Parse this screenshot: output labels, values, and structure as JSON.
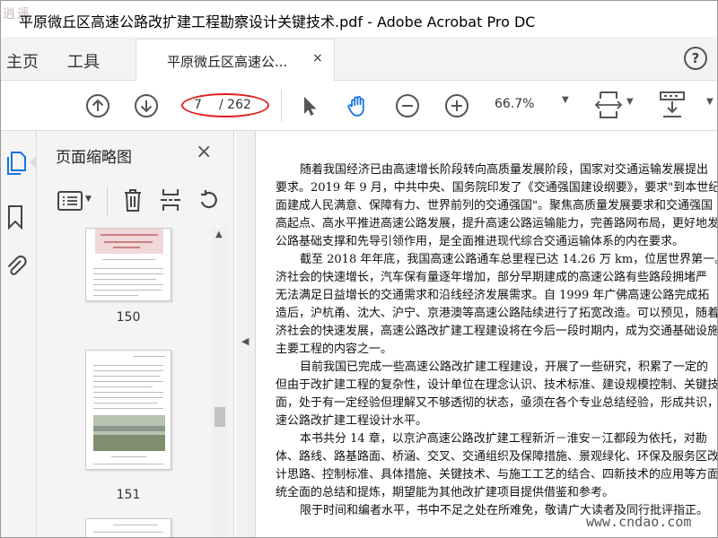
{
  "window": {
    "title": "平原微丘区高速公路改扩建工程勘察设计关键技术.pdf - Adobe Acrobat Pro DC",
    "corner_logo": "逍遥"
  },
  "menu": {
    "home": "主页",
    "tools": "工具",
    "doc_tab": "平原微丘区高速公...",
    "close_tab": "×",
    "help": "?"
  },
  "toolbar": {
    "page_current": "7",
    "page_total": "/ 262",
    "zoom": "66.7%"
  },
  "panel": {
    "title": "页面缩略图",
    "close": "×",
    "thumbs": [
      {
        "page": "150"
      },
      {
        "page": "151"
      }
    ]
  },
  "document": {
    "lines": [
      "随着我国经济已由高速增长阶段转向高质量发展阶段，国家对交通运输发展提出",
      "要求。2019 年 9 月，中共中央、国务院印发了《交通强国建设纲要》，要求\"到本世纪中",
      "面建成人民满意、保障有力、世界前列的交通强国\"。聚焦高质量发展要求和交通强国",
      "高起点、高水平推进高速公路发展，提升高速公路运输能力，完善路网布局，更好地发挥",
      "公路基础支撑和先导引领作用，是全面推进现代综合交通运输体系的内在要求。",
      "截至 2018 年年底，我国高速公路通车总里程已达 14.26 万 km，位居世界第一。",
      "济社会的快速增长，汽车保有量逐年增加，部分早期建成的高速公路有些路段拥堵严",
      "无法满足日益增长的交通需求和沿线经济发展需求。自 1999 年广佛高速公路完成拓",
      "造后，沪杭甬、沈大、沪宁、京港澳等高速公路陆续进行了拓宽改造。可以预见，随着我",
      "济社会的快速发展，高速公路改扩建工程建设将在今后一段时期内，成为交通基础设施",
      "主要工程的内容之一。",
      "目前我国已完成一些高速公路改扩建工程建设，开展了一些研究，积累了一定的",
      "但由于改扩建工程的复杂性，设计单位在理念认识、技术标准、建设规模控制、关键技术",
      "面，处于有一定经验但理解又不够透彻的状态，亟须在各个专业总结经验，形成共识，提",
      "速公路改扩建工程设计水平。",
      "本书共分 14 章，以京沪高速公路改扩建工程新沂－淮安－江都段为依托，对勘",
      "体、路线、路基路面、桥涵、交叉、交通组织及保障措施、景观绿化、环保及服务区改造等",
      "计思路、控制标准、具体措施、关键技术、与施工工艺的结合、四新技术的应用等方面进",
      "统全面的总结和提炼，期望能为其他改扩建项目提供借鉴和参考。",
      "限于时间和编者水平，书中不足之处在所难免，敬请广大读者及同行批评指正。"
    ]
  },
  "watermark": "www.cndao.com",
  "colors": {
    "accent_blue": "#1473e6",
    "highlight_red": "#e02020"
  }
}
